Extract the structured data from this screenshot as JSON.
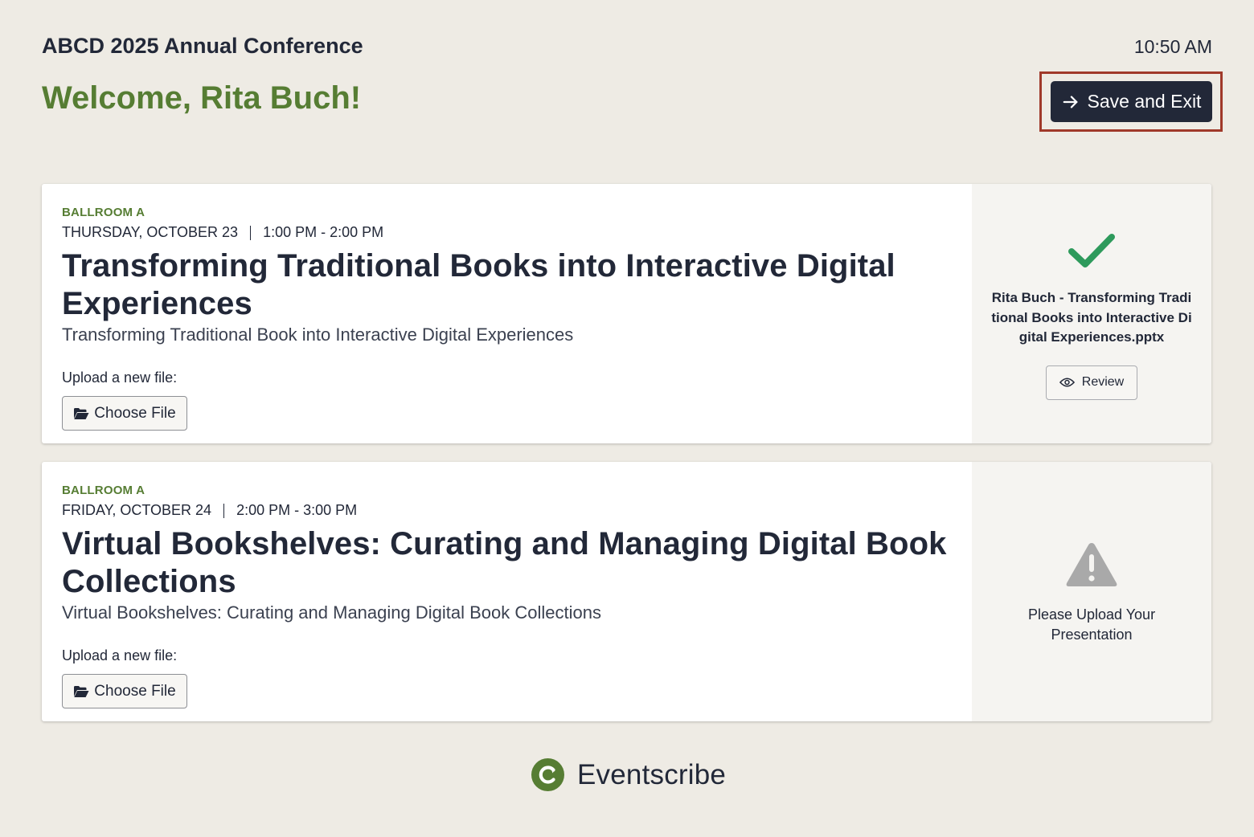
{
  "header": {
    "conference_title": "ABCD 2025 Annual Conference",
    "time": "10:50 AM",
    "welcome": "Welcome, Rita Buch!",
    "save_exit_label": "Save and Exit"
  },
  "sessions": [
    {
      "room": "BALLROOM A",
      "date": "THURSDAY, OCTOBER 23",
      "time": "1:00 PM - 2:00 PM",
      "title": "Transforming Traditional Books into Interactive Digital Experiences",
      "subtitle": "Transforming Traditional Book into Interactive Digital Experiences",
      "upload_label": "Upload a new file:",
      "choose_file_label": "Choose File",
      "status": "uploaded",
      "file_name": "Rita Buch - Transforming Traditional Books into Interactive Digital Experiences.pptx",
      "review_label": "Review"
    },
    {
      "room": "BALLROOM A",
      "date": "FRIDAY, OCTOBER 24",
      "time": "2:00 PM - 3:00 PM",
      "title": "Virtual Bookshelves: Curating and Managing Digital Book Collections",
      "subtitle": "Virtual Bookshelves: Curating and Managing Digital Book Collections",
      "upload_label": "Upload a new file:",
      "choose_file_label": "Choose File",
      "status": "missing",
      "warning_text": "Please Upload Your Presentation"
    }
  ],
  "footer": {
    "brand": "Eventscribe"
  },
  "icons": {
    "save": "arrow-right-icon",
    "choose": "folder-open-icon",
    "uploaded": "checkmark-icon",
    "review": "eye-icon",
    "missing": "warning-triangle-icon",
    "brand": "eventscribe-logo-icon"
  },
  "colors": {
    "background": "#eeebe4",
    "accent_green": "#567d33",
    "dark": "#222838",
    "check_green": "#2e9a5c",
    "warning_gray": "#a9a9a9",
    "highlight_outline": "#a0392a"
  }
}
